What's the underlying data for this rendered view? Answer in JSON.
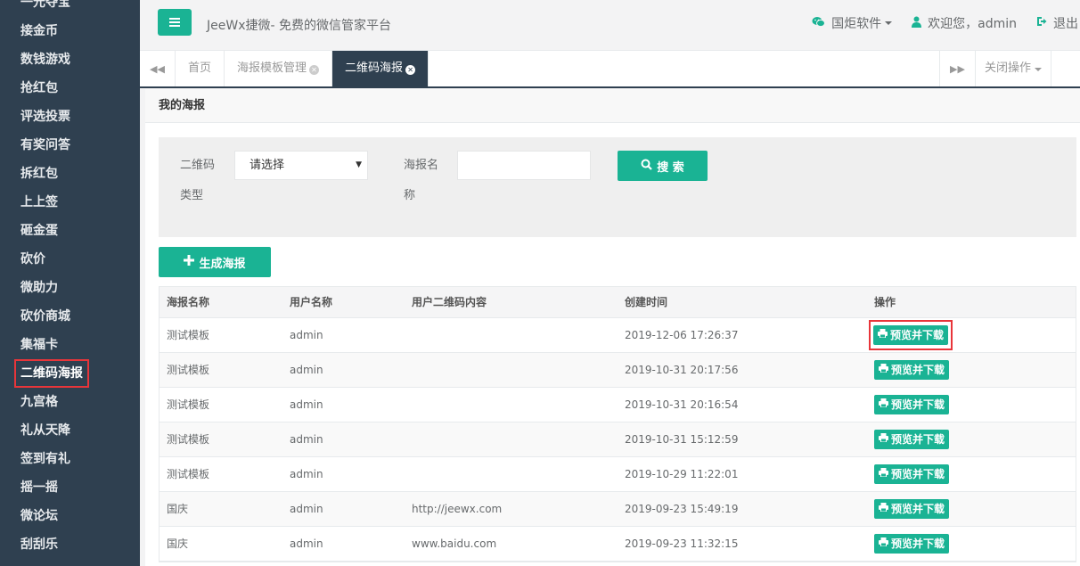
{
  "sidebar": {
    "items": [
      {
        "label": "一元夺宝"
      },
      {
        "label": "接金币"
      },
      {
        "label": "数钱游戏"
      },
      {
        "label": "抢红包"
      },
      {
        "label": "评选投票"
      },
      {
        "label": "有奖问答"
      },
      {
        "label": "拆红包"
      },
      {
        "label": "上上签"
      },
      {
        "label": "砸金蛋"
      },
      {
        "label": "砍价"
      },
      {
        "label": "微助力"
      },
      {
        "label": "砍价商城"
      },
      {
        "label": "集福卡"
      },
      {
        "label": "二维码海报"
      },
      {
        "label": "九宫格"
      },
      {
        "label": "礼从天降"
      },
      {
        "label": "签到有礼"
      },
      {
        "label": "摇一摇"
      },
      {
        "label": "微论坛"
      },
      {
        "label": "刮刮乐"
      }
    ],
    "active_index": 13
  },
  "header": {
    "title": "JeeWx捷微- 免费的微信管家平台",
    "company": "国炬软件",
    "welcome": "欢迎您，admin",
    "logout": "退出"
  },
  "tabs": {
    "items": [
      {
        "label": "首页",
        "closable": false
      },
      {
        "label": "海报模板管理",
        "closable": true
      },
      {
        "label": "二维码海报",
        "closable": true,
        "active": true
      }
    ],
    "close_ops": "关闭操作"
  },
  "panel": {
    "title": "我的海报",
    "search": {
      "qr_type_label_1": "二维码",
      "qr_type_label_2": "类型",
      "qr_type_value": "请选择",
      "poster_name_label_1": "海报名",
      "poster_name_label_2": "称",
      "poster_name_value": "",
      "search_button": "搜 索"
    },
    "generate_button": "生成海报"
  },
  "table": {
    "headers": [
      "海报名称",
      "用户名称",
      "用户二维码内容",
      "创建时间",
      "操作"
    ],
    "action_label": "预览并下载",
    "rows": [
      {
        "name": "测试模板",
        "user": "admin",
        "qr": "",
        "time": "2019-12-06 17:26:37"
      },
      {
        "name": "测试模板",
        "user": "admin",
        "qr": "",
        "time": "2019-10-31 20:17:56"
      },
      {
        "name": "测试模板",
        "user": "admin",
        "qr": "",
        "time": "2019-10-31 20:16:54"
      },
      {
        "name": "测试模板",
        "user": "admin",
        "qr": "",
        "time": "2019-10-31 15:12:59"
      },
      {
        "name": "测试模板",
        "user": "admin",
        "qr": "",
        "time": "2019-10-29 11:22:01"
      },
      {
        "name": "国庆",
        "user": "admin",
        "qr": "http://jeewx.com",
        "time": "2019-09-23 15:49:19"
      },
      {
        "name": "国庆",
        "user": "admin",
        "qr": "www.baidu.com",
        "time": "2019-09-23 11:32:15"
      }
    ]
  },
  "colors": {
    "sidebar_bg": "#2f4050",
    "accent": "#1ab394",
    "highlight": "#e8353a"
  }
}
